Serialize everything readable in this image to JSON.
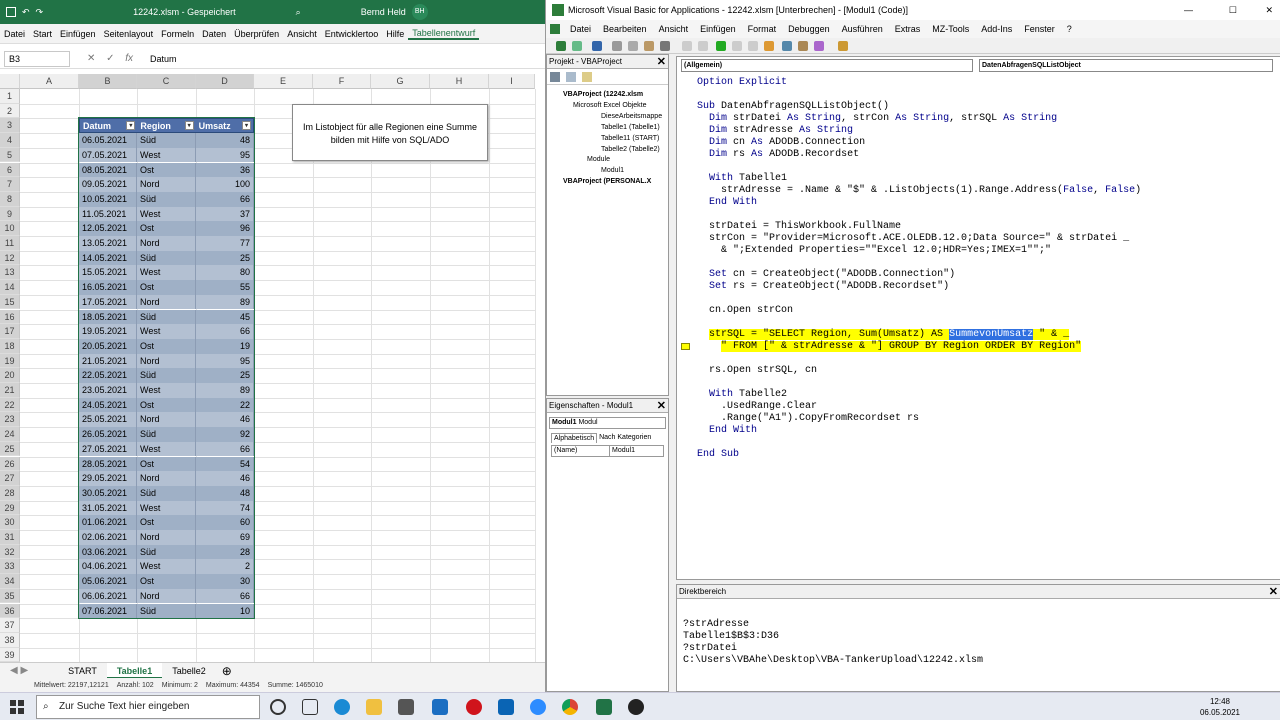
{
  "excel": {
    "title": "12242.xlsm - Gespeichert",
    "user": "Bernd Held",
    "user_initials": "BH",
    "menu": [
      "Datei",
      "Start",
      "Einfügen",
      "Seitenlayout",
      "Formeln",
      "Daten",
      "Überprüfen",
      "Ansicht",
      "Entwicklertoo",
      "Hilfe",
      "Tabellenentwurf"
    ],
    "namebox": "B3",
    "fx": "fx",
    "formula": "Datum",
    "columns": [
      "A",
      "B",
      "C",
      "D",
      "E",
      "F",
      "G",
      "H",
      "I"
    ],
    "rows": [
      "1",
      "2",
      "3",
      "4",
      "5",
      "6",
      "7",
      "8",
      "9",
      "10",
      "11",
      "12",
      "13",
      "14",
      "15",
      "16",
      "17",
      "18",
      "19",
      "20",
      "21",
      "22",
      "23",
      "24",
      "25",
      "26",
      "27",
      "28",
      "29",
      "30",
      "31",
      "32",
      "33",
      "34",
      "35",
      "36",
      "37",
      "38",
      "39"
    ],
    "table_headers": [
      "Datum",
      "Region",
      "Umsatz"
    ],
    "table": [
      [
        "06.05.2021",
        "Süd",
        "48"
      ],
      [
        "07.05.2021",
        "West",
        "95"
      ],
      [
        "08.05.2021",
        "Ost",
        "36"
      ],
      [
        "09.05.2021",
        "Nord",
        "100"
      ],
      [
        "10.05.2021",
        "Süd",
        "66"
      ],
      [
        "11.05.2021",
        "West",
        "37"
      ],
      [
        "12.05.2021",
        "Ost",
        "96"
      ],
      [
        "13.05.2021",
        "Nord",
        "77"
      ],
      [
        "14.05.2021",
        "Süd",
        "25"
      ],
      [
        "15.05.2021",
        "West",
        "80"
      ],
      [
        "16.05.2021",
        "Ost",
        "55"
      ],
      [
        "17.05.2021",
        "Nord",
        "89"
      ],
      [
        "18.05.2021",
        "Süd",
        "45"
      ],
      [
        "19.05.2021",
        "West",
        "66"
      ],
      [
        "20.05.2021",
        "Ost",
        "19"
      ],
      [
        "21.05.2021",
        "Nord",
        "95"
      ],
      [
        "22.05.2021",
        "Süd",
        "25"
      ],
      [
        "23.05.2021",
        "West",
        "89"
      ],
      [
        "24.05.2021",
        "Ost",
        "22"
      ],
      [
        "25.05.2021",
        "Nord",
        "46"
      ],
      [
        "26.05.2021",
        "Süd",
        "92"
      ],
      [
        "27.05.2021",
        "West",
        "66"
      ],
      [
        "28.05.2021",
        "Ost",
        "54"
      ],
      [
        "29.05.2021",
        "Nord",
        "46"
      ],
      [
        "30.05.2021",
        "Süd",
        "48"
      ],
      [
        "31.05.2021",
        "West",
        "74"
      ],
      [
        "01.06.2021",
        "Ost",
        "60"
      ],
      [
        "02.06.2021",
        "Nord",
        "69"
      ],
      [
        "03.06.2021",
        "Süd",
        "28"
      ],
      [
        "04.06.2021",
        "West",
        "2"
      ],
      [
        "05.06.2021",
        "Ost",
        "30"
      ],
      [
        "06.06.2021",
        "Nord",
        "66"
      ],
      [
        "07.06.2021",
        "Süd",
        "10"
      ]
    ],
    "textbox_line1": "Im Listobject für alle Regionen eine Summe",
    "textbox_line2": "bilden mit Hilfe von SQL/ADO",
    "sheets": [
      "START",
      "Tabelle1",
      "Tabelle2"
    ],
    "active_sheet": "Tabelle1",
    "status": {
      "avg": "Mittelwert: 22197,12121",
      "count": "Anzahl: 102",
      "min": "Minimum: 2",
      "max": "Maximum: 44354",
      "sum": "Summe: 1465010"
    }
  },
  "vba": {
    "title": "Microsoft Visual Basic for Applications - 12242.xlsm [Unterbrechen] - [Modul1 (Code)]",
    "menu": [
      "Datei",
      "Bearbeiten",
      "Ansicht",
      "Einfügen",
      "Format",
      "Debuggen",
      "Ausführen",
      "Extras",
      "MZ-Tools",
      "Add-Ins",
      "Fenster",
      "?"
    ],
    "project_title": "Projekt - VBAProject",
    "tree": [
      "VBAProject (12242.xlsm",
      "Microsoft Excel Objekte",
      "DieseArbeitsmappe",
      "Tabelle1 (Tabelle1)",
      "Tabelle11 (START)",
      "Tabelle2 (Tabelle2)",
      "Module",
      "Modul1",
      "VBAProject (PERSONAL.X"
    ],
    "props_title": "Eigenschaften - Modul1",
    "props_object": "Modul1",
    "props_type": "Modul",
    "props_tabs": [
      "Alphabetisch",
      "Nach Kategorien"
    ],
    "props_name_key": "(Name)",
    "props_name_val": "Modul1",
    "combo_left": "(Allgemein)",
    "combo_right": "DatenAbfragenSQLListObject",
    "immediate_title": "Direktbereich",
    "immediate_lines": [
      "?strAdresse",
      "Tabelle1$B$3:D36",
      "?strDatei",
      "C:\\Users\\VBAhe\\Desktop\\VBA-TankerUpload\\12242.xlsm"
    ]
  },
  "taskbar": {
    "search": "Zur Suche Text hier eingeben",
    "time": "12:48",
    "date": "06.05.2021"
  },
  "colors": {
    "excel_green": "#217346",
    "table_body": "#a6b4c8",
    "table_header": "#4f6ea8",
    "highlight": "#ffff00"
  }
}
